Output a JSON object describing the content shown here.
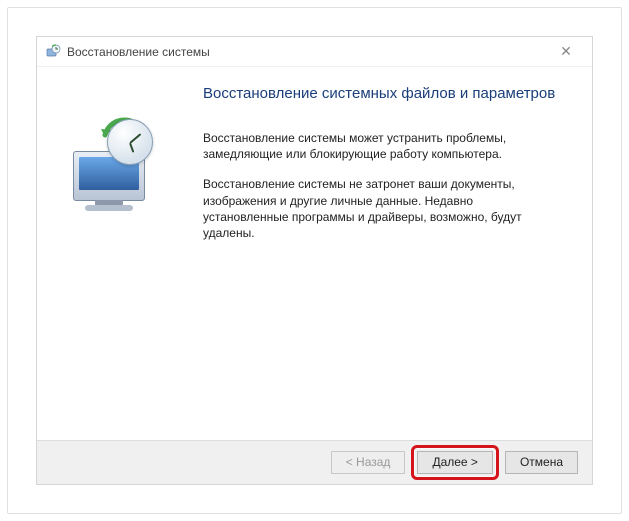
{
  "window": {
    "title": "Восстановление системы"
  },
  "main": {
    "heading": "Восстановление системных файлов и параметров",
    "para1": "Восстановление системы может устранить проблемы, замедляющие или блокирующие работу компьютера.",
    "para2": "Восстановление системы не затронет ваши документы, изображения и другие личные данные. Недавно установленные программы и драйверы, возможно, будут удалены."
  },
  "buttons": {
    "back": "< Назад",
    "next": "Далее >",
    "cancel": "Отмена"
  }
}
